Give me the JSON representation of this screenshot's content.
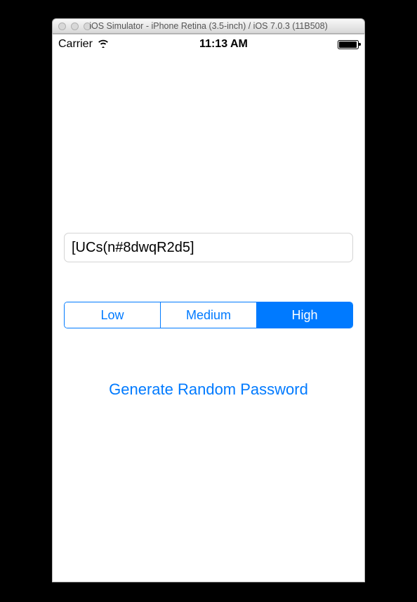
{
  "window": {
    "title": "iOS Simulator - iPhone Retina (3.5-inch) / iOS 7.0.3 (11B508)"
  },
  "status_bar": {
    "carrier": "Carrier",
    "time": "11:13 AM"
  },
  "password": {
    "value": "[UCs(n#8dwqR2d5]"
  },
  "segments": {
    "low": "Low",
    "medium": "Medium",
    "high": "High",
    "selected": "high"
  },
  "actions": {
    "generate": "Generate Random Password"
  }
}
